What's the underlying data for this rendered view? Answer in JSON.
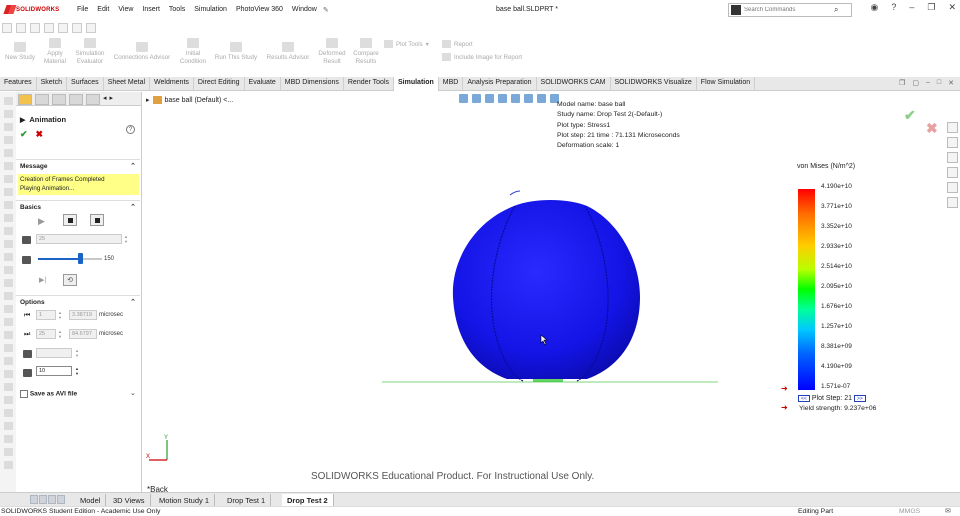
{
  "app": {
    "logo_text": "SOLIDWORKS",
    "menus": [
      "File",
      "Edit",
      "View",
      "Insert",
      "Tools",
      "Simulation",
      "PhotoView 360",
      "Window"
    ],
    "doc_title": "base ball.SLDPRT *",
    "search_placeholder": "Search Commands"
  },
  "commands": {
    "new_study": "New Study",
    "apply_material": [
      "Apply",
      "Material"
    ],
    "simulation_evaluator": [
      "Simulation",
      "Evaluator"
    ],
    "connections_advisor": "Connections Advisor",
    "initial_condition": [
      "Initial",
      "Condition"
    ],
    "run_this_study": "Run This Study",
    "results_advisor": "Results Advisor",
    "deformed_result": [
      "Deformed",
      "Result"
    ],
    "compare_results": [
      "Compare",
      "Results"
    ],
    "plot_tools": "Plot Tools",
    "report": "Report",
    "include_image": "Include Image for Report"
  },
  "tabs": [
    "Features",
    "Sketch",
    "Surfaces",
    "Sheet Metal",
    "Weldments",
    "Direct Editing",
    "Evaluate",
    "MBD Dimensions",
    "Render Tools",
    "Simulation",
    "MBD",
    "Analysis Preparation",
    "SOLIDWORKS CAM",
    "SOLIDWORKS Visualize",
    "Flow Simulation"
  ],
  "active_tab": "Simulation",
  "property_manager": {
    "title": "Animation",
    "message_header": "Message",
    "message_lines": [
      "Creation of Frames Completed",
      "Playing Animation..."
    ],
    "basics_header": "Basics",
    "frames_value": "25",
    "speed_value": "150",
    "speed_fraction": 0.65,
    "options_header": "Options",
    "start_frame": "1",
    "start_time": "3.38719",
    "end_frame": "25",
    "end_time": "84.6797",
    "time_unit": "microsec",
    "step_value": "10",
    "save_avi_label": "Save as AVI file"
  },
  "graphics": {
    "tree_node": "base ball (Default) <...",
    "study_info": [
      "Model name: base ball",
      "Study name: Drop Test 2(-Default-)",
      "Plot type:  Stress1",
      "Plot step: 21   time : 71.131 Microseconds",
      "Deformation scale: 1"
    ],
    "legend_title": "von Mises (N/m^2)",
    "legend_values": [
      "4.190e+10",
      "3.771e+10",
      "3.352e+10",
      "2.933e+10",
      "2.514e+10",
      "2.095e+10",
      "1.676e+10",
      "1.257e+10",
      "8.381e+09",
      "4.190e+09",
      "1.571e-07"
    ],
    "plot_step_label": "Plot Step:",
    "plot_step_value": "21",
    "prev_label": "<<",
    "next_label": ">>",
    "yield_strength": "Yield strength: 9.237e+06",
    "watermark": "SOLIDWORKS Educational Product. For Instructional Use Only.",
    "back_label": "*Back",
    "triad_y": "Y",
    "triad_x": "X"
  },
  "bottom_tabs": [
    "Model",
    "3D Views",
    "Motion Study 1",
    "Drop Test 1",
    "Drop Test 2"
  ],
  "active_bottom_tab": "Drop Test 2",
  "status": {
    "edition": "SOLIDWORKS Student Edition - Academic Use Only",
    "mode": "Editing Part",
    "units": "MMGS"
  },
  "colors": {
    "ball": "#1515e8",
    "ground_line": "#7cd67c",
    "accent_blue": "#1a64c8",
    "message_bg": "#ffff88"
  }
}
